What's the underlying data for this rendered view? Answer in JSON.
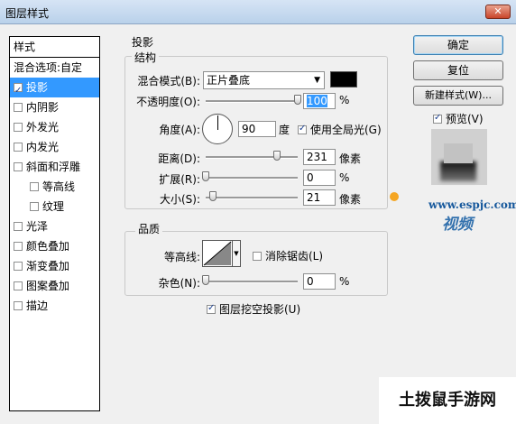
{
  "window": {
    "title": "图层样式"
  },
  "left_panel": {
    "header": "样式",
    "items": [
      {
        "label": "混合选项:自定",
        "checkbox": false,
        "checked": false,
        "indent": false,
        "selected": false
      },
      {
        "label": "投影",
        "checkbox": true,
        "checked": true,
        "indent": false,
        "selected": true
      },
      {
        "label": "内阴影",
        "checkbox": true,
        "checked": false,
        "indent": false,
        "selected": false
      },
      {
        "label": "外发光",
        "checkbox": true,
        "checked": false,
        "indent": false,
        "selected": false
      },
      {
        "label": "内发光",
        "checkbox": true,
        "checked": false,
        "indent": false,
        "selected": false
      },
      {
        "label": "斜面和浮雕",
        "checkbox": true,
        "checked": false,
        "indent": false,
        "selected": false
      },
      {
        "label": "等高线",
        "checkbox": true,
        "checked": false,
        "indent": true,
        "selected": false
      },
      {
        "label": "纹理",
        "checkbox": true,
        "checked": false,
        "indent": true,
        "selected": false
      },
      {
        "label": "光泽",
        "checkbox": true,
        "checked": false,
        "indent": false,
        "selected": false
      },
      {
        "label": "颜色叠加",
        "checkbox": true,
        "checked": false,
        "indent": false,
        "selected": false
      },
      {
        "label": "渐变叠加",
        "checkbox": true,
        "checked": false,
        "indent": false,
        "selected": false
      },
      {
        "label": "图案叠加",
        "checkbox": true,
        "checked": false,
        "indent": false,
        "selected": false
      },
      {
        "label": "描边",
        "checkbox": true,
        "checked": false,
        "indent": false,
        "selected": false
      }
    ]
  },
  "drop_shadow": {
    "section_title": "投影",
    "structure": {
      "title": "结构",
      "blend_mode_label": "混合模式(B):",
      "blend_mode_value": "正片叠底",
      "shadow_color": "#000000",
      "opacity_label": "不透明度(O):",
      "opacity_value": "100",
      "opacity_unit": "%",
      "opacity_fraction": 1.0,
      "angle_label": "角度(A):",
      "angle_value": "90",
      "angle_unit": "度",
      "global_light_label": "使用全局光(G)",
      "global_light_checked": true,
      "distance_label": "距离(D):",
      "distance_value": "231",
      "distance_unit": "像素",
      "distance_fraction": 0.77,
      "spread_label": "扩展(R):",
      "spread_value": "0",
      "spread_unit": "%",
      "spread_fraction": 0.0,
      "size_label": "大小(S):",
      "size_value": "21",
      "size_unit": "像素",
      "size_fraction": 0.08
    },
    "quality": {
      "title": "品质",
      "contour_label": "等高线:",
      "anti_alias_label": "消除锯齿(L)",
      "anti_alias_checked": false,
      "noise_label": "杂色(N):",
      "noise_value": "0",
      "noise_unit": "%",
      "noise_fraction": 0.0
    },
    "knockout_label": "图层挖空投影(U)",
    "knockout_checked": true
  },
  "buttons": {
    "ok": "确定",
    "reset": "复位",
    "new_style": "新建样式(W)...",
    "preview_label": "预览(V)",
    "preview_checked": true
  },
  "watermark": {
    "url": "www.espjc.com",
    "brand": "视频"
  },
  "footer_site": "土拨鼠手游网"
}
